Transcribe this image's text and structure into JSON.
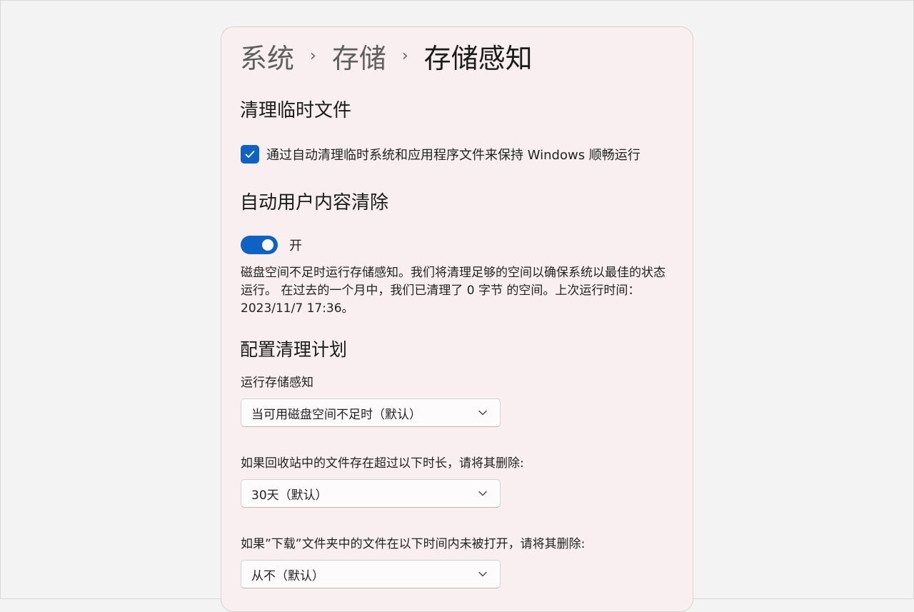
{
  "breadcrumb": {
    "items": [
      "系统",
      "存储",
      "存储感知"
    ],
    "separator": "›"
  },
  "temp_files": {
    "title": "清理临时文件",
    "checkbox_label": "通过自动清理临时系统和应用程序文件来保持 Windows 顺畅运行",
    "checked": true
  },
  "auto_cleanup": {
    "title": "自动用户内容清除",
    "toggle_label": "开",
    "toggle_on": true,
    "description": "磁盘空间不足时运行存储感知。我们将清理足够的空间以确保系统以最佳的状态运行。 在过去的一个月中，我们已清理了 0 字节 的空间。上次运行时间：2023/11/7 17:36。"
  },
  "schedule": {
    "title": "配置清理计划",
    "run_label": "运行存储感知",
    "run_value": "当可用磁盘空间不足时（默认）",
    "recycle_label": "如果回收站中的文件存在超过以下时长，请将其删除:",
    "recycle_value": "30天（默认）",
    "downloads_label": "如果”下载”文件夹中的文件在以下时间内未被打开，请将其删除:",
    "downloads_value": "从不（默认）"
  },
  "colors": {
    "accent": "#0f62c3",
    "panel_bg": "#f9eff0",
    "page_bg": "#f3f3f3"
  }
}
